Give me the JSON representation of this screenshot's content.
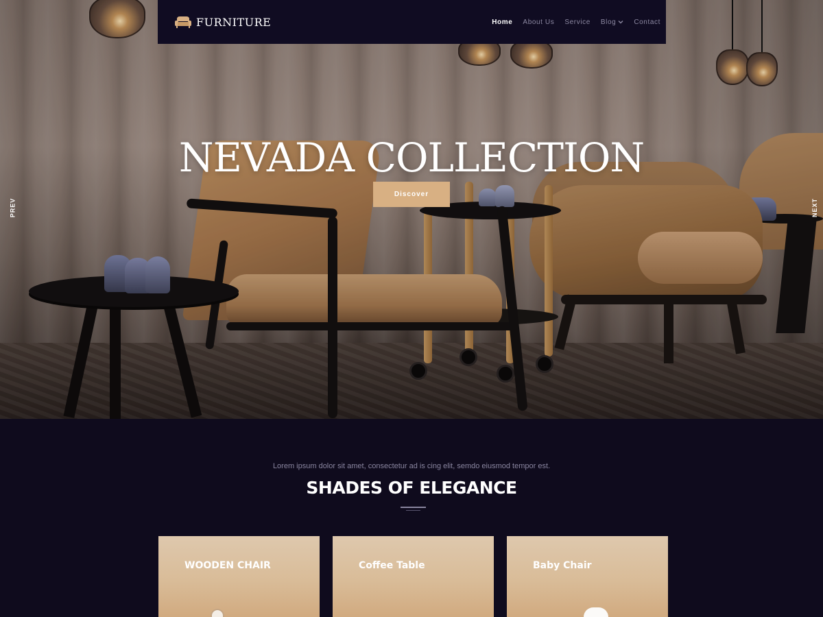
{
  "brand": {
    "name": "FURNITURE",
    "icon": "sofa-icon"
  },
  "nav": {
    "items": [
      {
        "label": "Home",
        "active": true
      },
      {
        "label": "About Us",
        "active": false
      },
      {
        "label": "Service",
        "active": false
      },
      {
        "label": "Blog",
        "active": false,
        "dropdown": true
      },
      {
        "label": "Contact",
        "active": false
      }
    ]
  },
  "hero": {
    "title": "NEVADA COLLECTION",
    "button_label": "Discover",
    "prev_label": "PREV",
    "next_label": "NEXT"
  },
  "section": {
    "subtitle": "Lorem ipsum dolor sit amet, consectetur ad is cing elit, semdo eiusmod tempor est.",
    "title": "SHADES OF ELEGANCE",
    "cards": [
      {
        "title": "WOODEN CHAIR"
      },
      {
        "title": "Coffee Table"
      },
      {
        "title": "Baby Chair"
      }
    ]
  },
  "colors": {
    "nav_bg": "#100c22",
    "page_bg": "#0f0b1d",
    "accent": "#d8b083",
    "muted_text": "#8a86a0"
  }
}
